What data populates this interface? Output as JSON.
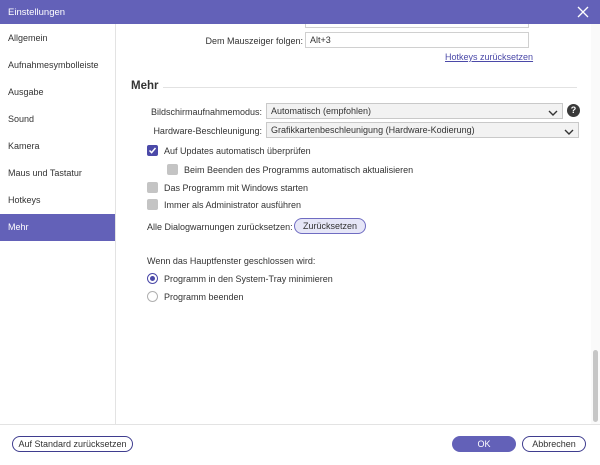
{
  "window": {
    "title": "Einstellungen"
  },
  "sidebar": {
    "items": [
      {
        "label": "Allgemein",
        "active": false
      },
      {
        "label": "Aufnahmesymbolleiste",
        "active": false
      },
      {
        "label": "Ausgabe",
        "active": false
      },
      {
        "label": "Sound",
        "active": false
      },
      {
        "label": "Kamera",
        "active": false
      },
      {
        "label": "Maus und Tastatur",
        "active": false
      },
      {
        "label": "Hotkeys",
        "active": false
      },
      {
        "label": "Mehr",
        "active": true
      }
    ]
  },
  "hotkeys": {
    "mouse_follow_label": "Dem Mauszeiger folgen:",
    "mouse_follow_value": "Alt+3",
    "reset_link": "Hotkeys zurücksetzen"
  },
  "more": {
    "section_title": "Mehr",
    "capture_mode_label": "Bildschirmaufnahmemodus:",
    "capture_mode_value": "Automatisch (empfohlen)",
    "hw_accel_label": "Hardware-Beschleunigung:",
    "hw_accel_value": "Grafikkartenbeschleunigung (Hardware-Kodierung)",
    "checkboxes": [
      {
        "label": "Auf Updates automatisch überprüfen",
        "checked": true
      },
      {
        "label": "Beim Beenden des Programms automatisch aktualisieren",
        "checked": false
      },
      {
        "label": "Das Programm mit Windows starten",
        "checked": false
      },
      {
        "label": "Immer als Administrator ausführen",
        "checked": false
      }
    ],
    "dialog_warnings_label": "Alle Dialogwarnungen zurücksetzen:",
    "dialog_warnings_button": "Zurücksetzen",
    "close_main_label": "Wenn das Hauptfenster geschlossen wird:",
    "close_options": [
      {
        "label": "Programm in den System-Tray minimieren",
        "selected": true
      },
      {
        "label": "Programm beenden",
        "selected": false
      }
    ]
  },
  "footer": {
    "reset_defaults": "Auf Standard zurücksetzen",
    "ok": "OK",
    "cancel": "Abbrechen"
  },
  "colors": {
    "accent": "#6361b8",
    "accent_dark": "#4b49a8",
    "checkbox_off": "#c4c4c4"
  },
  "icons": {
    "close": "close-icon",
    "chevron": "chevron-down-icon",
    "help": "help-icon",
    "check": "check-icon"
  }
}
